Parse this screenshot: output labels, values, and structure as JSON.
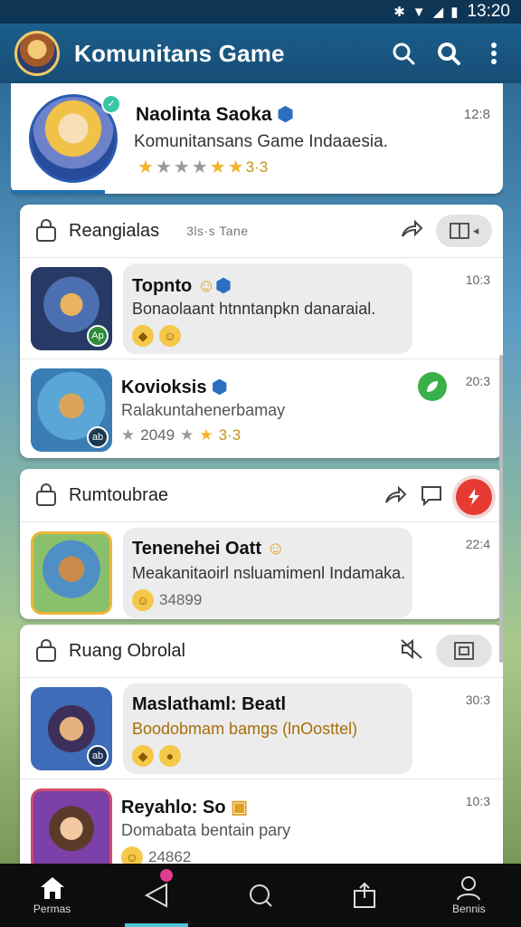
{
  "status_bar": {
    "time": "13:20",
    "icons": [
      "bluetooth-icon",
      "wifi-icon",
      "signal-icon",
      "battery-icon"
    ]
  },
  "app_bar": {
    "title": "Komunitans Game"
  },
  "profile": {
    "name": "Naolinta Saoka",
    "subtitle": "Komunitansans Game Indaaesia.",
    "rating_text": "3·3",
    "time": "12:8"
  },
  "sections": [
    {
      "title": "Reangialas",
      "count_label": "3ls·s Tane",
      "rows": [
        {
          "name": "Topnto",
          "text": "Bonaolaant htnntanpkn danaraial.",
          "time": "10:3",
          "badge": "Ap"
        },
        {
          "name": "Kovioksis",
          "text": "Ralakuntahenerbamay",
          "meta": "2049",
          "rating_text": "3·3",
          "time": "20:3",
          "badge": "ab"
        }
      ]
    },
    {
      "title": "Rumtoubrae",
      "rows": [
        {
          "name": "Tenenehei Oatt",
          "text": "Meakanitaoirl nsluamimenl Indamaka.",
          "meta": "34899",
          "time": "22:4"
        }
      ]
    },
    {
      "title": "Ruang Obrolal",
      "rows": [
        {
          "name": "Maslathaml: Beatl",
          "text": "Boodobmam bamgs (lnOosttel)",
          "time": "30:3",
          "badge": "ab"
        },
        {
          "name": "Reyahlo: So",
          "text": "Domabata bentain pary",
          "meta": "24862",
          "time": "10:3"
        }
      ]
    }
  ],
  "bottom_nav": [
    {
      "icon": "home-icon",
      "label": "Permas"
    },
    {
      "icon": "send-icon",
      "label": ""
    },
    {
      "icon": "search-icon",
      "label": ""
    },
    {
      "icon": "share-icon",
      "label": ""
    },
    {
      "icon": "profile-icon",
      "label": "Bennis"
    }
  ],
  "colors": {
    "app_bar": "#1b5e8c",
    "accent": "#4ec3d8",
    "star": "#f3b32a",
    "red_action": "#e63a32",
    "green_action": "#3ab04a"
  }
}
